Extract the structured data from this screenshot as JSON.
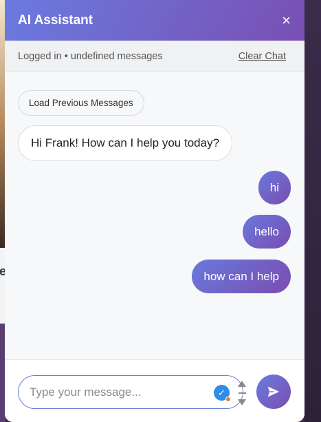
{
  "header": {
    "title": "AI Assistant",
    "close_icon": "×"
  },
  "status": {
    "text": "Logged in • undefined messages",
    "clear_label": "Clear Chat"
  },
  "messages": {
    "load_label": "Load Previous Messages",
    "bot": [
      "Hi Frank! How can I help you today?"
    ],
    "user": [
      "hi",
      "hello",
      "how can I help"
    ]
  },
  "composer": {
    "placeholder": "Type your message...",
    "send_icon": "send-icon"
  },
  "background": {
    "partial_letter": "e"
  },
  "colors": {
    "accent_start": "#6a7be0",
    "accent_end": "#7a4fb2",
    "check_blue": "#2e8de8",
    "check_dot_orange": "#f07b2a"
  }
}
